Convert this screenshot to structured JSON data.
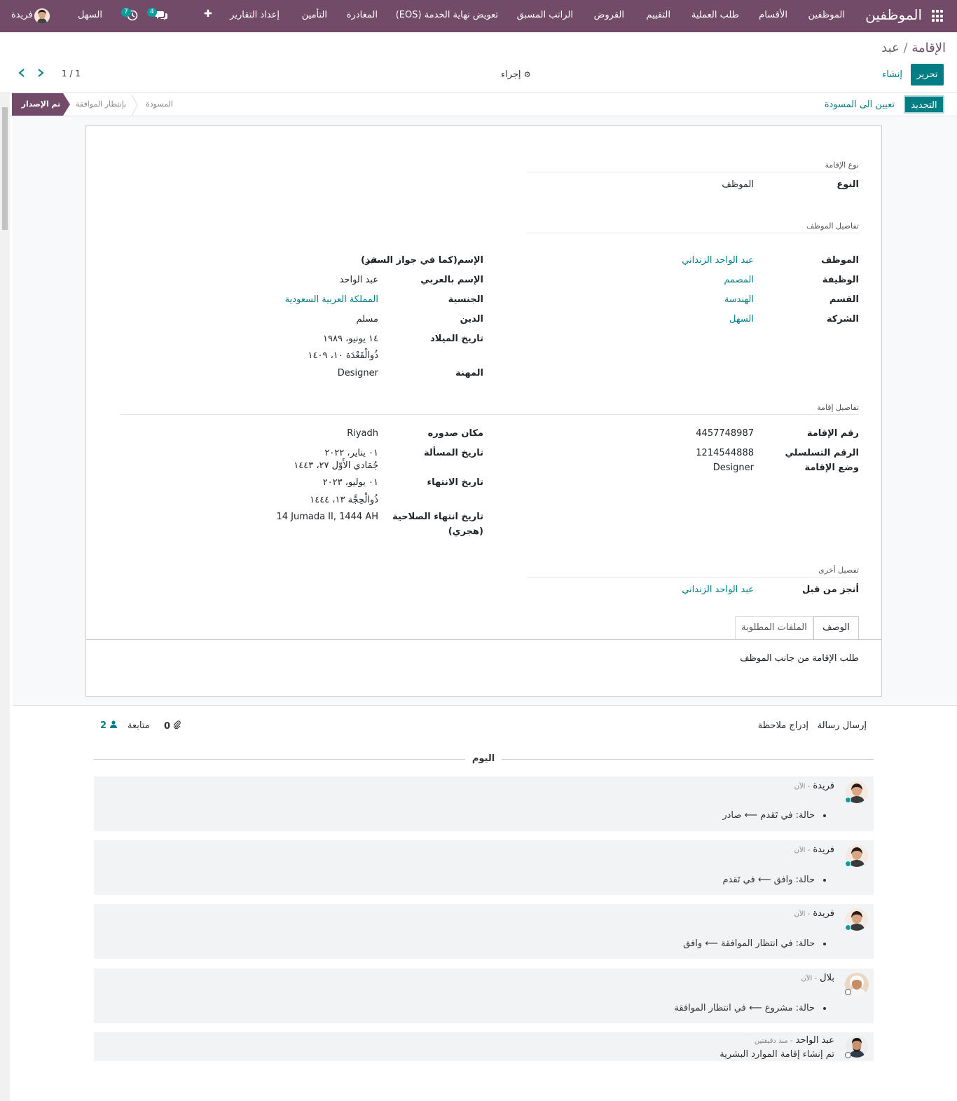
{
  "navbar": {
    "brand": "الموظفين",
    "menu": [
      "الموظفين",
      "الأقسام",
      "طلب العملية",
      "التقييم",
      "القروض",
      "الراتب المسبق",
      "تعويض نهاية الخدمة (EOS)",
      "المغادرة",
      "التأمين",
      "إعداد التقارير"
    ],
    "company": "السهل",
    "user": "فريدة",
    "messages_count": "4",
    "activities_count": "7",
    "add_symbol": "✚"
  },
  "breadcrumb": {
    "parent": "الإقامة",
    "separator": "/",
    "current": "عبد"
  },
  "buttons": {
    "edit": "تحرير",
    "create": "إنشاء",
    "action": "إجراء",
    "renew": "التجديد",
    "set_draft": "تعيين الى المسودة"
  },
  "pager": {
    "value": "1 / 1"
  },
  "stages": {
    "issued": "تم الإصدار",
    "waiting": "بإنتظار الموافقة",
    "draft": "المسودة"
  },
  "form": {
    "iqama_type": {
      "title": "نوع الإقامة",
      "type_label": "النوع",
      "type_value": "الموظف"
    },
    "employee_details": {
      "title": "تفاصيل الموظف",
      "employee_label": "الموظف",
      "employee_value": "عبد الواحد الزنداني",
      "job_label": "الوظيفة",
      "job_value": "المصمم",
      "department_label": "القسم",
      "department_value": "الهندسة",
      "company_label": "الشركة",
      "company_value": "السهل",
      "passport_name_label": "الإسم(كما في جواز السفر)",
      "passport_name_value": "عبد",
      "arabic_name_label": "الإسم بالعربي",
      "arabic_name_value": "عبد الواحد",
      "nationality_label": "الجنسية",
      "nationality_value": "المملكة العربية السعودية",
      "religion_label": "الدين",
      "religion_value": "مسلم",
      "birth_label": "تاريخ الميلاد",
      "birth_value": "١٤ يونيو، ١٩٨٩",
      "birth_hijri": "ذُوالْقَعْدَة ١٠، ١٤٠٩",
      "profession_label": "المهنة",
      "profession_value": "Designer"
    },
    "iqama_details": {
      "title": "تفاصيل إقامة",
      "number_label": "رقم الإقامة",
      "number_value": "4457748987",
      "serial_label": "الرقم التسلسلي",
      "serial_value": "1214544888",
      "status_label": "وضع الإقامة",
      "status_value": "Designer",
      "place_label": "مكان صدوره",
      "place_value": "Riyadh",
      "issue_label": "تاريخ المسألة",
      "issue_value": "٠١ يناير، ٢٠٢٢",
      "issue_hijri": "جُمَادي الأَوّل ٢٧، ١٤٤٣",
      "expiry_label": "تاريخ الانتهاء",
      "expiry_value": "٠١ يوليو، ٢٠٢٣",
      "expiry_hijri": "ذُوالْحِجَّة ١٣، ١٤٤٤",
      "expiry_hijri_label_1": "تاريخ انتهاء الصلاحية",
      "expiry_hijri_label_2": "(هجري)",
      "expiry_hijri_value": "14 Jumada II, 1444 AH"
    },
    "other": {
      "title": "تفصيل أخرى",
      "done_by_label": "أنجز من قبل",
      "done_by_value": "عبد الواحد الزنداني"
    },
    "tabs": {
      "description": "الوصف",
      "required_files": "الملفات المطلوبة"
    },
    "description_text": "طلب الإقامة من جانب الموظف"
  },
  "chatter": {
    "send_message": "إرسال رسالة",
    "log_note": "إدراج ملاحظة",
    "follow": "متابعة",
    "attachments_count": "0",
    "followers_count": "2",
    "date_separator": "اليوم",
    "messages": [
      {
        "author": "فريدة",
        "time": "- الآن",
        "body": "حالة: في تَقدم ⟵ صادر"
      },
      {
        "author": "فريدة",
        "time": "- الآن",
        "body": "حالة: وافق ⟵ في تَقدم"
      },
      {
        "author": "فريدة",
        "time": "- الآن",
        "body": "حالة: في انتظار الموافقة ⟵ وافق"
      },
      {
        "author": "بلال",
        "time": "- الآن",
        "body": "حالة: مشروع ⟵ في انتظار الموافقة"
      },
      {
        "author": "عبد الواحد",
        "time": "- منذ دقيقتين",
        "body": "تم إنشاء إقامة الموارد البشرية"
      }
    ]
  },
  "colors": {
    "brand": "#714B67",
    "primary": "#017E84",
    "online": "#00A09D"
  }
}
